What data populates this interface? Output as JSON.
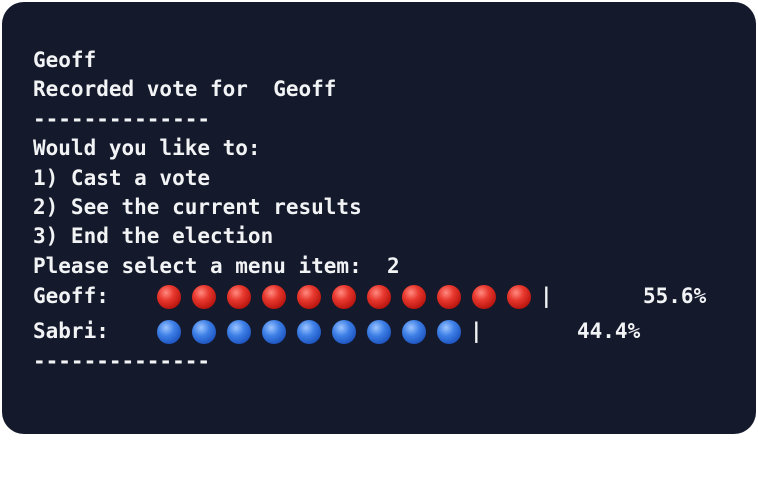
{
  "terminal": {
    "lines_top": [
      "Geoff",
      "Recorded vote for  Geoff",
      "--------------",
      "Would you like to:",
      "1) Cast a vote",
      "2) See the current results",
      "3) End the election",
      "Please select a menu item:  2"
    ],
    "results": [
      {
        "label": "Geoff:",
        "dot_count": 11,
        "dot_color": "#d8261e",
        "separator": "|",
        "percent": "55.6%"
      },
      {
        "label": "Sabri:",
        "dot_count": 9,
        "dot_color": "#2e6ad8",
        "separator": "|",
        "percent": "44.4%"
      }
    ],
    "divider_bottom": "--------------"
  },
  "colors": {
    "background": "#141a2c",
    "text": "#f2f3f5",
    "geoff_dot": "#d8261e",
    "sabri_dot": "#2e6ad8"
  }
}
